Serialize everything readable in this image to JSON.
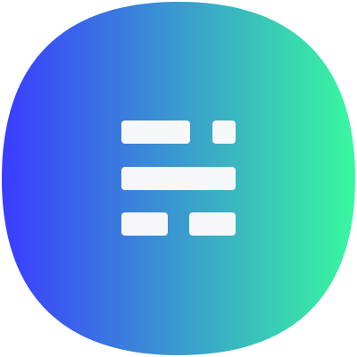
{
  "icon": {
    "name": "app-icon",
    "glyph": "layout-blocks-icon",
    "shape": "squircle"
  },
  "colors": {
    "gradient_start": "#3a3cff",
    "gradient_end": "#39f89f",
    "glyph_fill": "#f6f7f9"
  }
}
